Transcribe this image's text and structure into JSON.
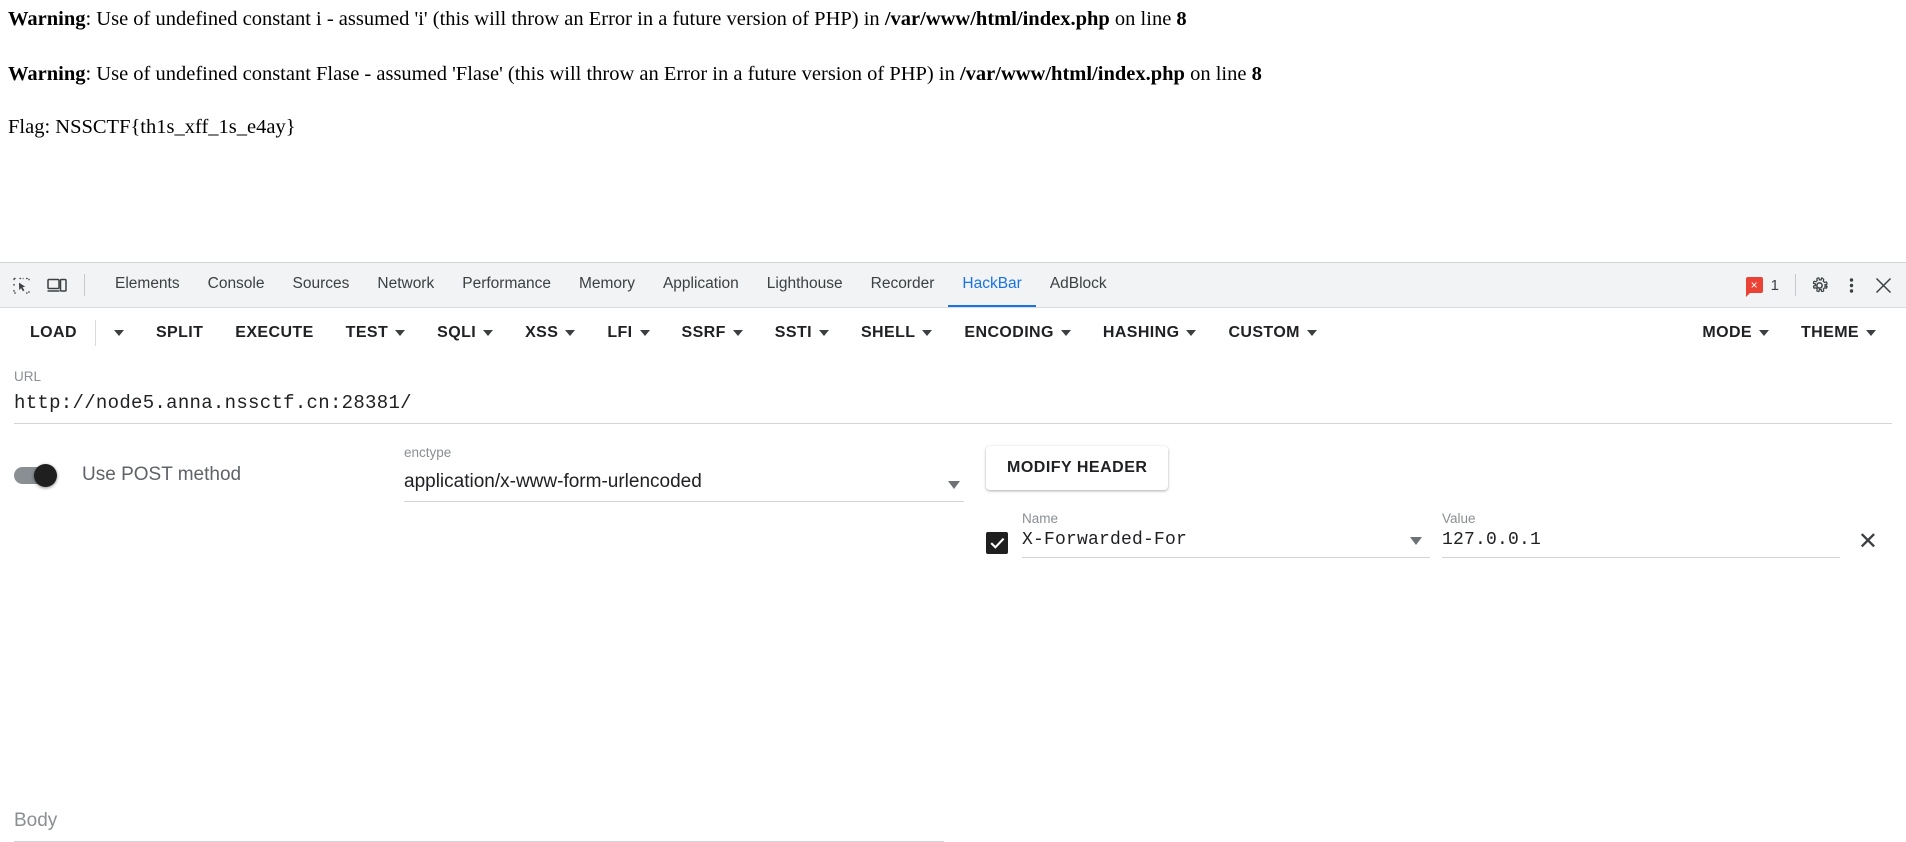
{
  "page": {
    "warnings": [
      {
        "label": "Warning",
        "text_before": ": Use of undefined constant i - assumed 'i' (this will throw an Error in a future version of PHP) in ",
        "file": "/var/www/html/index.php",
        "text_middle": " on line ",
        "line": "8"
      },
      {
        "label": "Warning",
        "text_before": ": Use of undefined constant Flase - assumed 'Flase' (this will throw an Error in a future version of PHP) in ",
        "file": "/var/www/html/index.php",
        "text_middle": " on line ",
        "line": "8"
      }
    ],
    "flag": "Flag: NSSCTF{th1s_xff_1s_e4ay}"
  },
  "devtools": {
    "icons": {
      "inspect": "inspect-element-icon",
      "device": "device-toolbar-icon"
    },
    "tabs": [
      {
        "label": "Elements",
        "active": false
      },
      {
        "label": "Console",
        "active": false
      },
      {
        "label": "Sources",
        "active": false
      },
      {
        "label": "Network",
        "active": false
      },
      {
        "label": "Performance",
        "active": false
      },
      {
        "label": "Memory",
        "active": false
      },
      {
        "label": "Application",
        "active": false
      },
      {
        "label": "Lighthouse",
        "active": false
      },
      {
        "label": "Recorder",
        "active": false
      },
      {
        "label": "HackBar",
        "active": true
      },
      {
        "label": "AdBlock",
        "active": false
      }
    ],
    "error_count": "1",
    "error_badge_glyph": "×",
    "settings_icon": "gear-icon",
    "more_icon": "kebab-menu-icon",
    "close_icon": "close-icon",
    "accent_color": "#1a73e8",
    "error_color": "#ea4335"
  },
  "hackbar": {
    "toolbar": [
      {
        "label": "LOAD",
        "has_caret": false,
        "split_caret": true
      },
      {
        "label": "SPLIT",
        "has_caret": false,
        "split_caret": false
      },
      {
        "label": "EXECUTE",
        "has_caret": false,
        "split_caret": false
      },
      {
        "label": "TEST",
        "has_caret": true,
        "split_caret": false
      },
      {
        "label": "SQLI",
        "has_caret": true,
        "split_caret": false
      },
      {
        "label": "XSS",
        "has_caret": true,
        "split_caret": false
      },
      {
        "label": "LFI",
        "has_caret": true,
        "split_caret": false
      },
      {
        "label": "SSRF",
        "has_caret": true,
        "split_caret": false
      },
      {
        "label": "SSTI",
        "has_caret": true,
        "split_caret": false
      },
      {
        "label": "SHELL",
        "has_caret": true,
        "split_caret": false
      },
      {
        "label": "ENCODING",
        "has_caret": true,
        "split_caret": false
      },
      {
        "label": "HASHING",
        "has_caret": true,
        "split_caret": false
      },
      {
        "label": "CUSTOM",
        "has_caret": true,
        "split_caret": false
      }
    ],
    "toolbar_right": [
      {
        "label": "MODE",
        "has_caret": true
      },
      {
        "label": "THEME",
        "has_caret": true
      }
    ],
    "url": {
      "label": "URL",
      "value": "http://node5.anna.nssctf.cn:28381/"
    },
    "post": {
      "label": "Use POST method",
      "enabled": false
    },
    "enctype": {
      "label": "enctype",
      "value": "application/x-www-form-urlencoded"
    },
    "modify_header_label": "MODIFY HEADER",
    "header_row": {
      "checked": true,
      "name_label": "Name",
      "name_value": "X-Forwarded-For",
      "value_label": "Value",
      "value_value": "127.0.0.1",
      "remove_glyph": "✕"
    },
    "body": {
      "label": "Body",
      "value": ""
    }
  }
}
